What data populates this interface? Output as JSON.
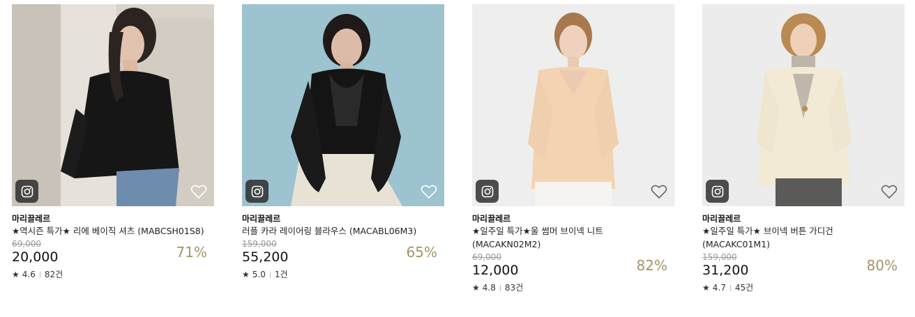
{
  "products": [
    {
      "brand": "마리끌레르",
      "name": "★역시즌 특가★ 리에 베이직 셔츠 (MABCSH01S8)",
      "original_price": "69,000",
      "price": "20,000",
      "discount": "71%",
      "rating": "4.6",
      "reviews": "82건"
    },
    {
      "brand": "마리끌레르",
      "name": "러플 카라 레이어링 블라우스 (MACABL06M3)",
      "original_price": "159,000",
      "price": "55,200",
      "discount": "65%",
      "rating": "5.0",
      "reviews": "1건"
    },
    {
      "brand": "마리끌레르",
      "name": "★일주일 특가★울 썸머 브이넥 니트 (MACAKN02M2)",
      "original_price": "69,000",
      "price": "12,000",
      "discount": "82%",
      "rating": "4.8",
      "reviews": "83건"
    },
    {
      "brand": "마리끌레르",
      "name": "★일주일 특가★ 브이넥 버튼 가디건 (MACAKC01M1)",
      "original_price": "159,000",
      "price": "31,200",
      "discount": "80%",
      "rating": "4.7",
      "reviews": "45건"
    }
  ],
  "colors": {
    "discount": "#a49468",
    "overlay": "#2a2a2a"
  },
  "icons": {
    "share": "instagram-icon",
    "wishlist": "heart-icon",
    "rating": "star-icon"
  }
}
